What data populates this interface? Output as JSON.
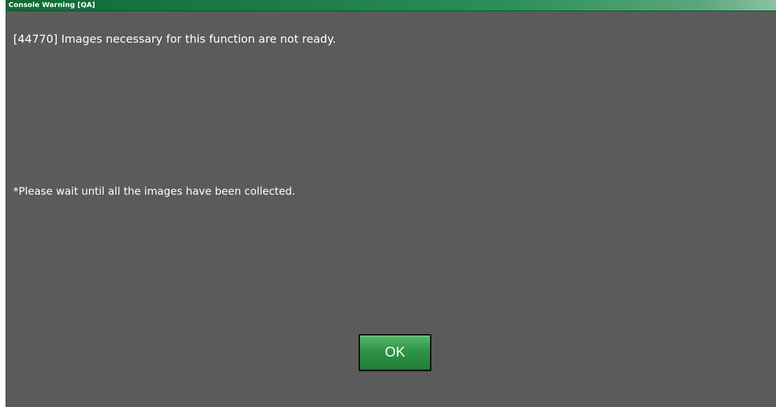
{
  "window": {
    "title": "Console Warning [QA]"
  },
  "message": {
    "primary": "[44770] Images necessary for this function are not ready.",
    "note": "*Please wait until all the images have been collected."
  },
  "buttons": {
    "ok_label": "OK"
  },
  "colors": {
    "titlebar_accent": "#1a7d44",
    "background": "#5b5b5b",
    "button": "#2f9446",
    "text": "#ffffff"
  }
}
